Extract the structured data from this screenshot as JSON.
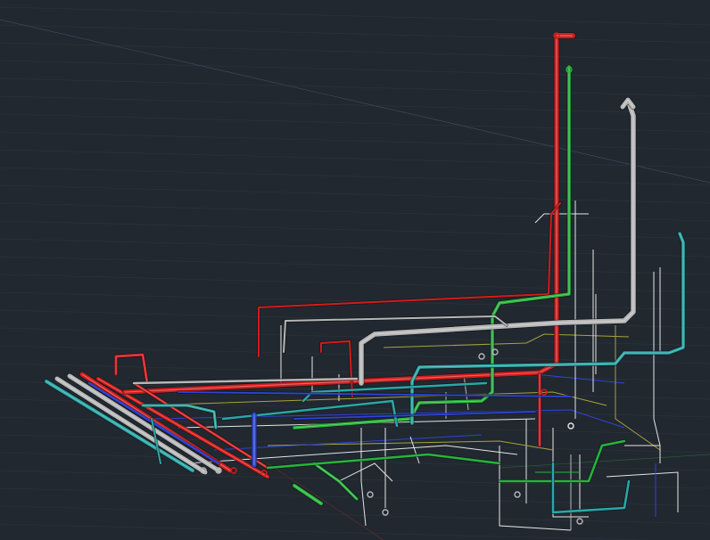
{
  "app": {
    "viewport_label": "",
    "visual_style": "3D Wireframe piping model"
  },
  "colors": {
    "background": "#212830",
    "grid": "#2c353f",
    "grid_axis": "#3c4a58",
    "pipe_red": "#d21c1c",
    "pipe_green": "#27b53a",
    "pipe_gray": "#b7b7b7",
    "pipe_cyan": "#2aa7a7",
    "pipe_blue": "#2e44d8",
    "pipe_yellow": "#a8a23a",
    "pipe_white": "#e6e6e6"
  },
  "model": {
    "systems": [
      "red",
      "green",
      "gray",
      "cyan",
      "blue",
      "yellow",
      "white"
    ]
  }
}
